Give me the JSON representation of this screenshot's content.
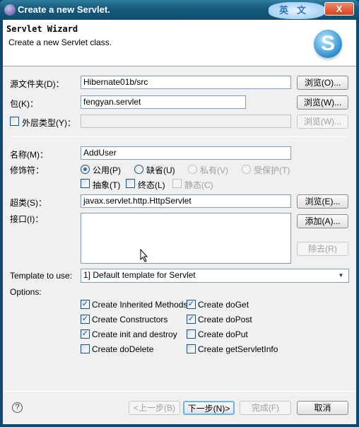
{
  "window": {
    "title": "Create a new Servlet.",
    "ime_label": "英文",
    "close_label": "X"
  },
  "header": {
    "title": "Servlet Wizard",
    "description": "Create a new Servlet class.",
    "logo_letter": "S"
  },
  "form": {
    "source_folder": {
      "label": "源文件夹(D)：",
      "value": "Hibernate01b/src",
      "browse": "浏览(O)..."
    },
    "package": {
      "label": "包(K)：",
      "value": "fengyan.servlet",
      "browse": "浏览(W)..."
    },
    "enclosing_type": {
      "label": "外层类型(Y)：",
      "value": "",
      "browse": "浏览(W)...",
      "checked": false
    },
    "name": {
      "label": "名称(M)：",
      "value": "AddUser"
    },
    "modifiers": {
      "label": "修饰符：",
      "radios": [
        {
          "label": "公用(P)",
          "selected": true,
          "enabled": true
        },
        {
          "label": "缺省(U)",
          "selected": false,
          "enabled": true
        },
        {
          "label": "私有(V)",
          "selected": false,
          "enabled": false
        },
        {
          "label": "受保护(T)",
          "selected": false,
          "enabled": false
        }
      ],
      "checks": [
        {
          "label": "抽象(T)",
          "checked": false,
          "enabled": true
        },
        {
          "label": "终态(L)",
          "checked": false,
          "enabled": true
        },
        {
          "label": "静态(C)",
          "checked": false,
          "enabled": false
        }
      ]
    },
    "superclass": {
      "label": "超类(S)：",
      "value": "javax.servlet.http.HttpServlet",
      "browse": "浏览(E)..."
    },
    "interfaces": {
      "label": "接口(I)：",
      "items": [],
      "add": "添加(A)...",
      "remove": "除去(R)"
    },
    "template": {
      "label": "Template to use:",
      "value": "1] Default template for Servlet"
    },
    "options": {
      "label": "Options:",
      "items": [
        {
          "label": "Create Inherited Methods",
          "checked": true
        },
        {
          "label": "Create doGet",
          "checked": true
        },
        {
          "label": "Create Constructors",
          "checked": true
        },
        {
          "label": "Create doPost",
          "checked": true
        },
        {
          "label": "Create init and destroy",
          "checked": true
        },
        {
          "label": "Create doPut",
          "checked": false
        },
        {
          "label": "Create doDelete",
          "checked": false
        },
        {
          "label": "Create getServletInfo",
          "checked": false
        }
      ]
    }
  },
  "footer": {
    "help_icon": "?",
    "back": "<上一步(B)",
    "next": "下一步(N)>",
    "finish": "完成(F)",
    "cancel": "取消"
  }
}
